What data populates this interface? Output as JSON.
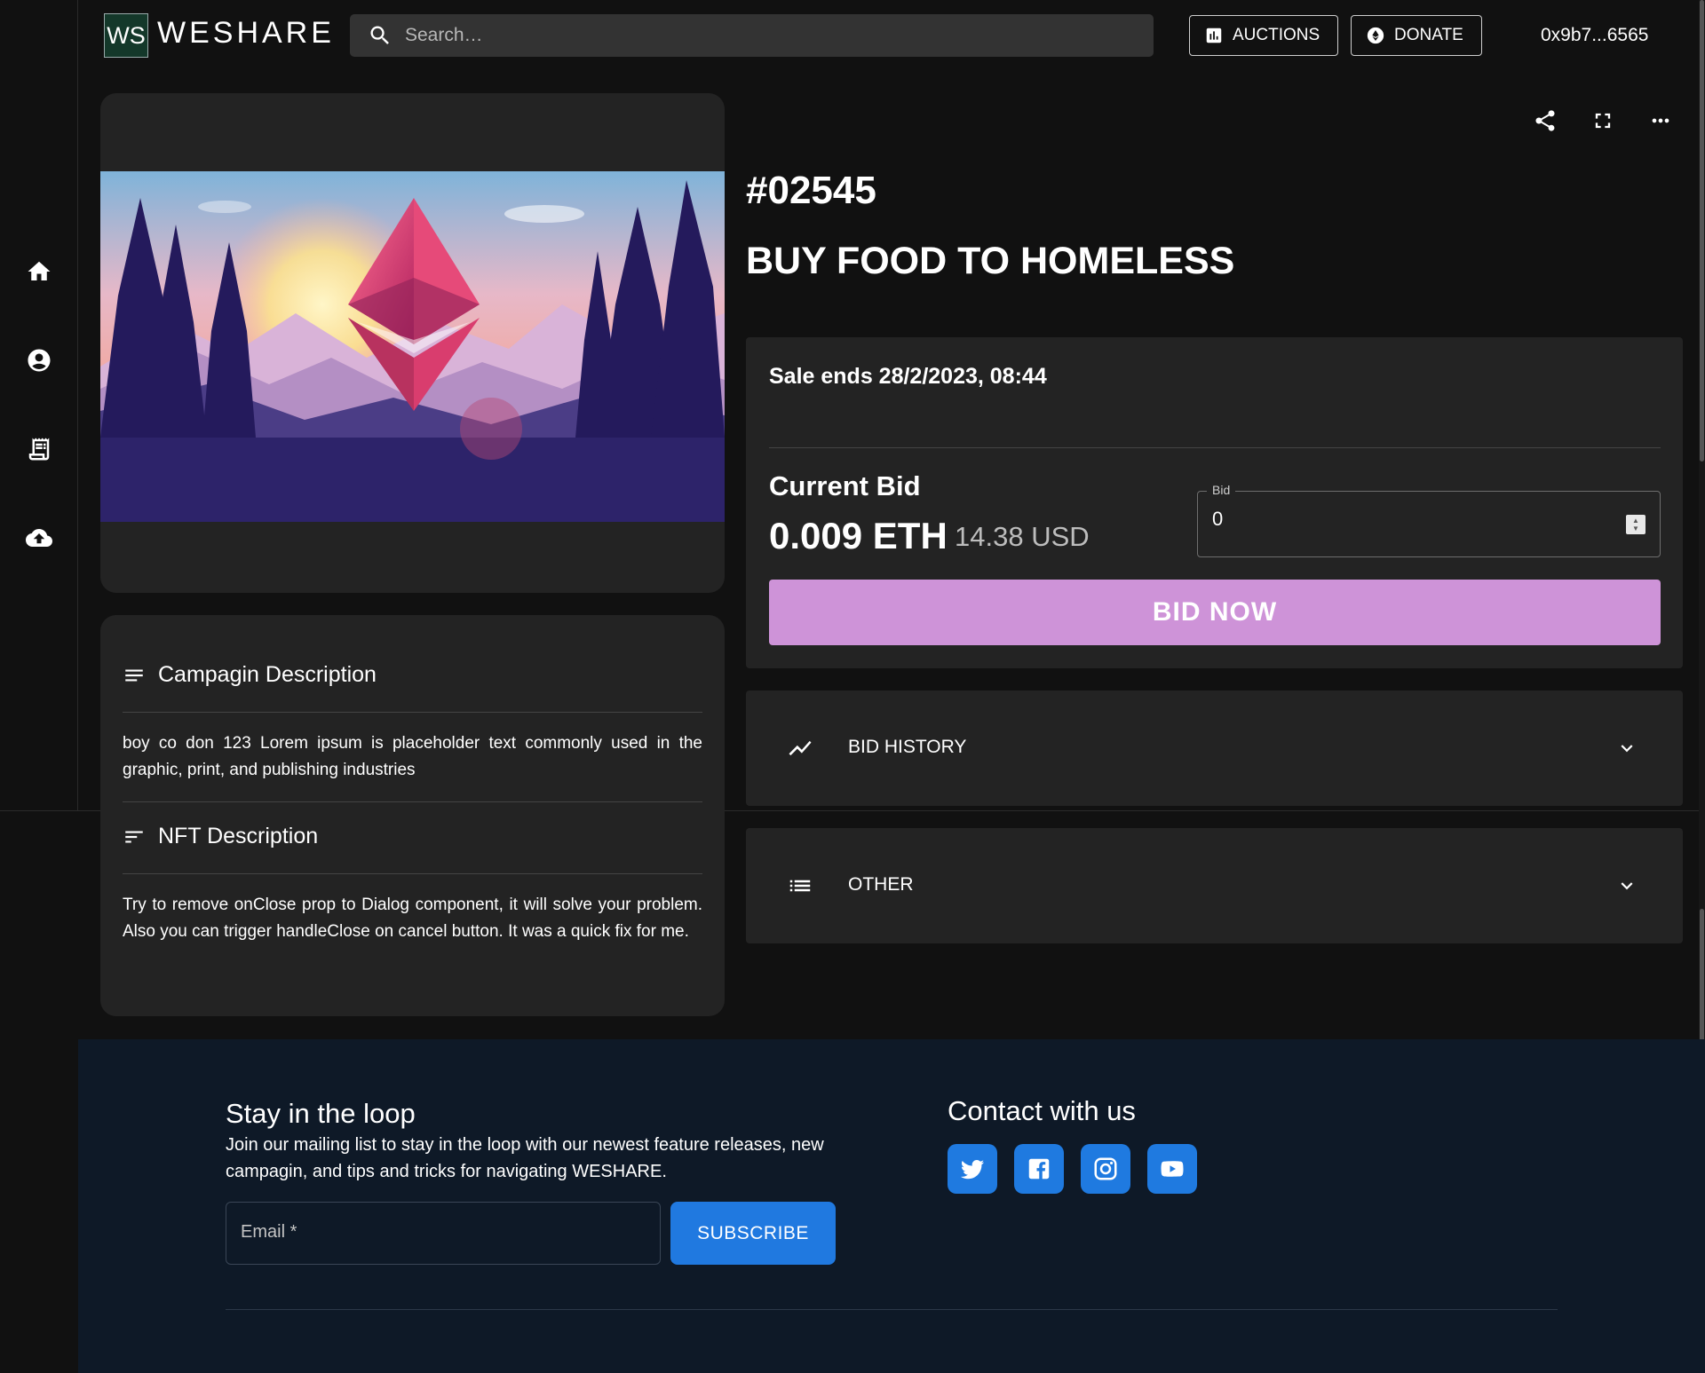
{
  "app": {
    "logo_text": "WS",
    "brand": "WESHARE",
    "wallet": "0x9b7...6565"
  },
  "search": {
    "placeholder": "Search…"
  },
  "nav": {
    "auctions_label": "AUCTIONS",
    "donate_label": "DONATE"
  },
  "sidebar": {
    "items": [
      {
        "icon": "home-icon"
      },
      {
        "icon": "account-circle-icon"
      },
      {
        "icon": "receipt-icon"
      },
      {
        "icon": "cloud-upload-icon"
      }
    ]
  },
  "nft": {
    "id": "#02545",
    "title": "BUY FOOD TO HOMELESS",
    "image_alt": "Ethereum logo over mountain landscape"
  },
  "sale": {
    "ends_text": "Sale ends 28/2/2023, 08:44",
    "current_bid_label": "Current Bid",
    "current_bid_eth": "0.009 ETH",
    "current_bid_usd": "14.38 USD",
    "bid_field_label": "Bid",
    "bid_value": "0",
    "bid_button": "BID NOW",
    "bid_button_color": "#ce93d8"
  },
  "accordions": [
    {
      "label": "BID HISTORY",
      "icon": "trending-icon"
    },
    {
      "label": "OTHER",
      "icon": "list-icon"
    }
  ],
  "campaign": {
    "heading": "Campagin Description",
    "text": "boy co don 123 Lorem ipsum is placeholder text commonly used in the graphic, print, and publishing industries"
  },
  "nft_description": {
    "heading": "NFT Description",
    "text": "Try to remove onClose prop to Dialog component, it will solve your problem. Also you can trigger handleClose on cancel button. It was a quick fix for me."
  },
  "footer": {
    "loop_title": "Stay in the loop",
    "loop_text": "Join our mailing list to stay in the loop with our newest feature releases, new campagin, and tips and tricks for navigating WESHARE.",
    "email_placeholder": "Email *",
    "subscribe_label": "SUBSCRIBE",
    "contact_title": "Contact with us",
    "socials": [
      "twitter-icon",
      "facebook-icon",
      "instagram-icon",
      "youtube-icon"
    ],
    "accent_color": "#1f7ae0"
  },
  "colors": {
    "background": "#111111",
    "card": "#232323",
    "footer": "#0e1927"
  }
}
